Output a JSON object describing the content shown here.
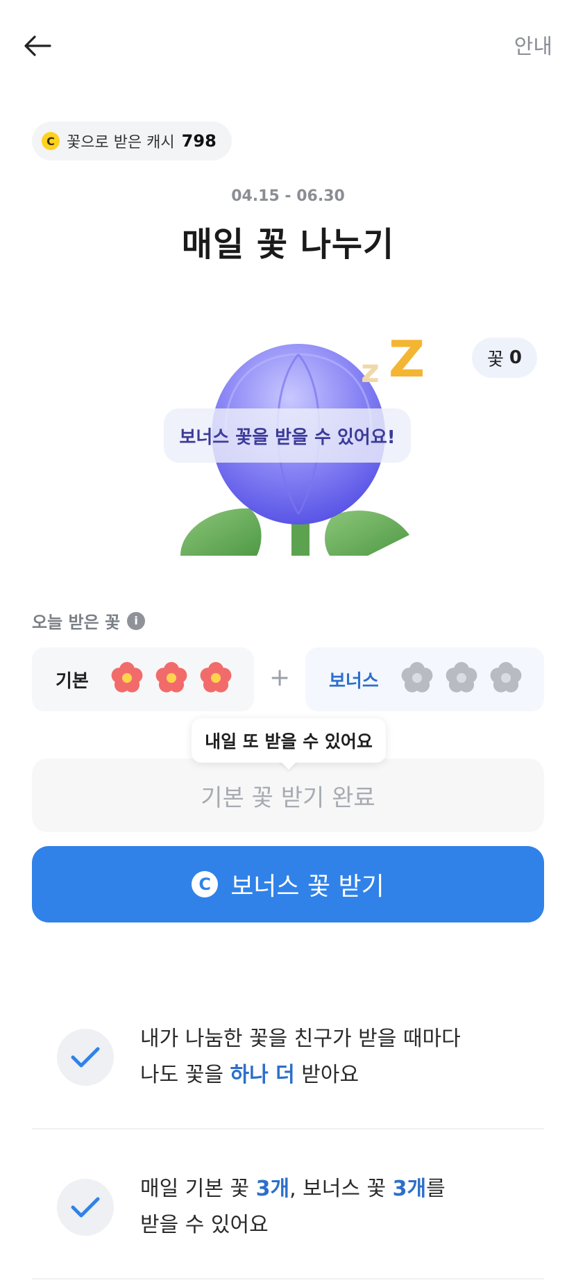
{
  "header": {
    "guide_label": "안내"
  },
  "cash": {
    "label": "꽃으로 받은 캐시",
    "amount": "798",
    "coin_symbol": "C"
  },
  "event": {
    "date_range": "04.15 - 06.30",
    "title": "매일 꽃 나누기"
  },
  "illustration": {
    "flower_count_label": "꽃",
    "flower_count_value": "0",
    "bonus_message": "보너스 꽃을 받을 수 있어요!",
    "sleep_letters": [
      "z",
      "Z"
    ]
  },
  "today": {
    "label": "오늘 받은 꽃",
    "basic_label": "기본",
    "basic_received": 3,
    "basic_total": 3,
    "plus": "+",
    "bonus_label": "보너스",
    "bonus_received": 0,
    "bonus_total": 3
  },
  "tooltip": "내일 또 받을 수 있어요",
  "buttons": {
    "basic_done": "기본 꽃 받기 완료",
    "bonus_receive": "보너스 꽃 받기",
    "coin_symbol": "C"
  },
  "benefits": [
    {
      "line1": "내가 나눔한 꽃을 친구가 받을 때마다",
      "line2_pre": "나도 꽃을 ",
      "line2_hl": "하나 더",
      "line2_post": " 받아요"
    },
    {
      "line1_pre": "매일 기본 꽃 ",
      "line1_hl1": "3개",
      "line1_mid": ", 보너스 꽃 ",
      "line1_hl2": "3개",
      "line1_post": "를",
      "line2": "받을 수 있어요"
    }
  ],
  "colors": {
    "primary": "#3082e8",
    "highlight": "#2c6fca",
    "flower_received": "#f26b6b",
    "flower_empty": "#b8bcc2",
    "coin": "#ffd21f"
  }
}
